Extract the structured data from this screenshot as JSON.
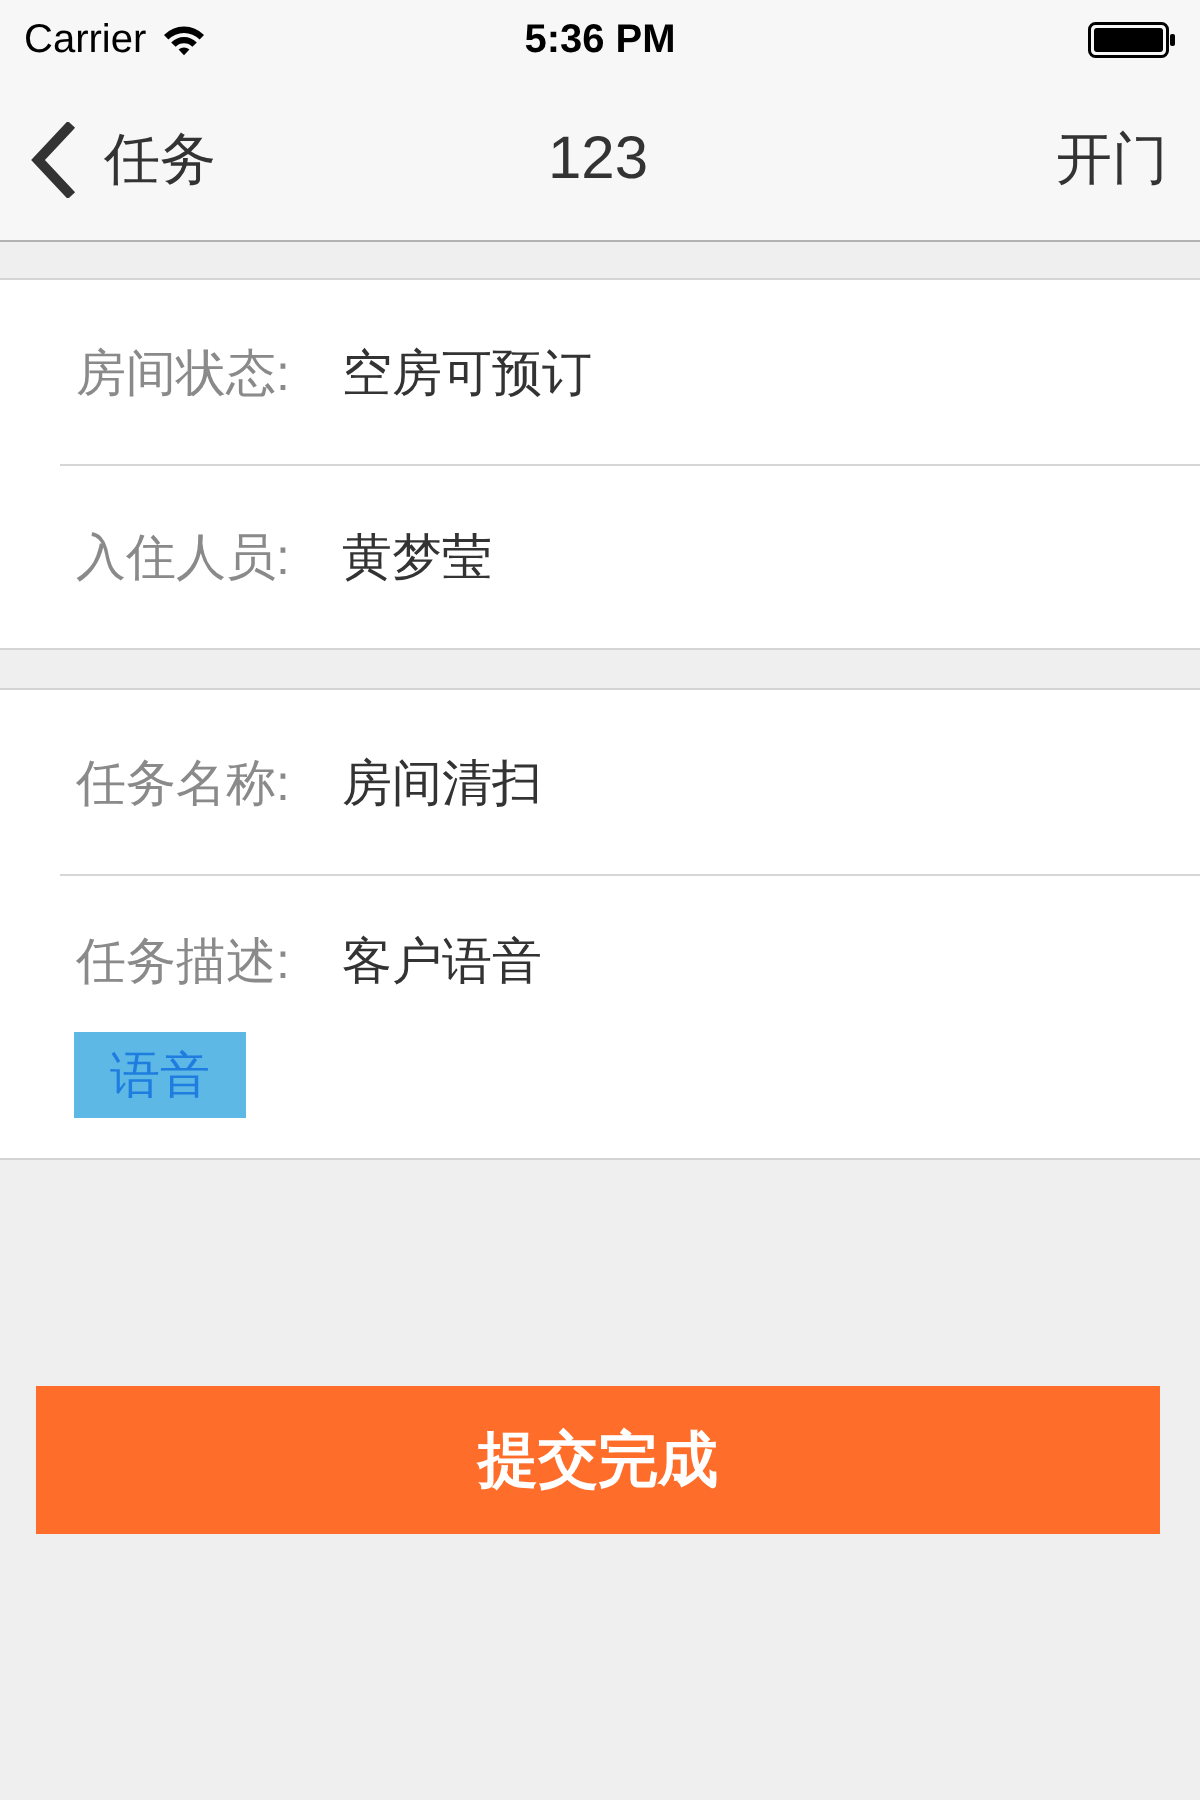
{
  "status_bar": {
    "carrier": "Carrier",
    "time": "5:36 PM"
  },
  "nav_bar": {
    "back_label": "任务",
    "title": "123",
    "action": "开门"
  },
  "sections": [
    {
      "rows": [
        {
          "label": "房间状态:",
          "value": "空房可预订"
        },
        {
          "label": "入住人员:",
          "value": "黄梦莹"
        }
      ]
    },
    {
      "rows": [
        {
          "label": "任务名称:",
          "value": "房间清扫"
        },
        {
          "label": "任务描述:",
          "value": "客户语音",
          "tag": "语音"
        }
      ]
    }
  ],
  "submit_button": "提交完成"
}
